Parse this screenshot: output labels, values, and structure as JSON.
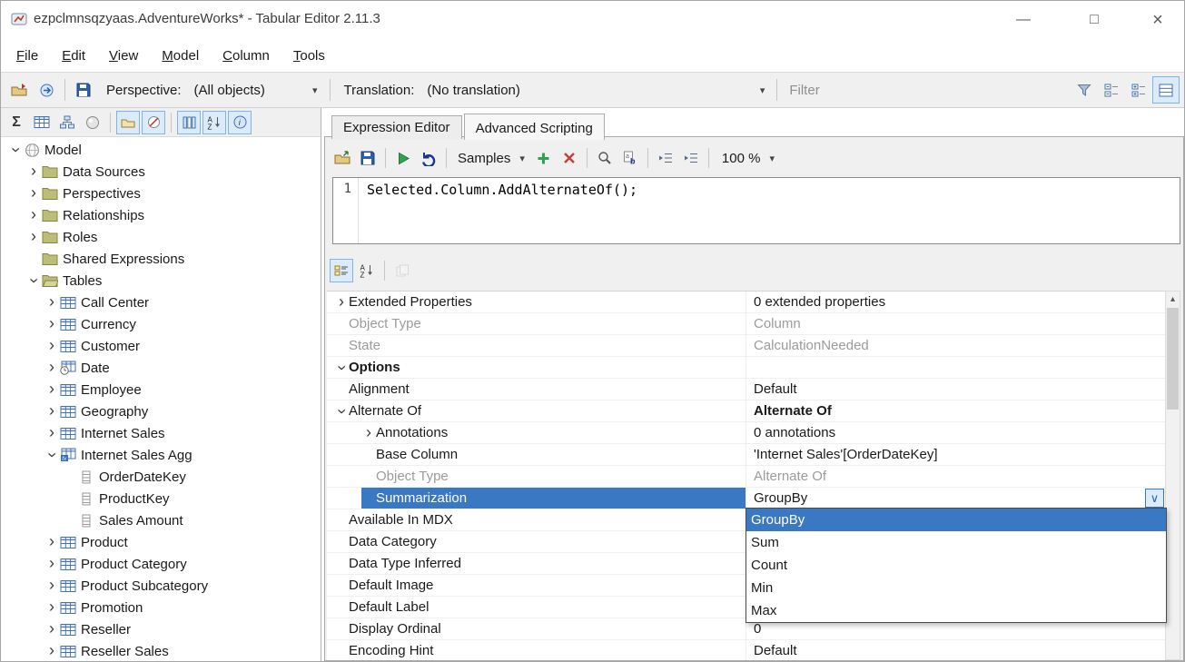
{
  "window": {
    "title": "ezpclmnsqzyaas.AdventureWorks* - Tabular Editor 2.11.3",
    "controls": {
      "minimize": "—",
      "maximize": "□",
      "close": "×"
    }
  },
  "menu": {
    "items": [
      "File",
      "Edit",
      "View",
      "Model",
      "Column",
      "Tools"
    ]
  },
  "main_toolbar": {
    "perspective_label": "Perspective:",
    "perspective_value": "(All objects)",
    "translation_label": "Translation:",
    "translation_value": "(No translation)",
    "filter_placeholder": "Filter"
  },
  "explorer_tree": {
    "items": [
      {
        "label": "Model",
        "level": 0,
        "expand": "expanded",
        "icon": "model-icon"
      },
      {
        "label": "Data Sources",
        "level": 1,
        "expand": "collapsed",
        "icon": "folder-icon"
      },
      {
        "label": "Perspectives",
        "level": 1,
        "expand": "collapsed",
        "icon": "folder-icon"
      },
      {
        "label": "Relationships",
        "level": 1,
        "expand": "collapsed",
        "icon": "folder-icon"
      },
      {
        "label": "Roles",
        "level": 1,
        "expand": "collapsed",
        "icon": "folder-icon"
      },
      {
        "label": "Shared Expressions",
        "level": 1,
        "expand": "none",
        "icon": "folder-icon"
      },
      {
        "label": "Tables",
        "level": 1,
        "expand": "expanded",
        "icon": "folder-open-icon"
      },
      {
        "label": "Call Center",
        "level": 2,
        "expand": "collapsed",
        "icon": "table-icon"
      },
      {
        "label": "Currency",
        "level": 2,
        "expand": "collapsed",
        "icon": "table-icon"
      },
      {
        "label": "Customer",
        "level": 2,
        "expand": "collapsed",
        "icon": "table-icon"
      },
      {
        "label": "Date",
        "level": 2,
        "expand": "collapsed",
        "icon": "date-table-icon"
      },
      {
        "label": "Employee",
        "level": 2,
        "expand": "collapsed",
        "icon": "table-icon"
      },
      {
        "label": "Geography",
        "level": 2,
        "expand": "collapsed",
        "icon": "table-icon"
      },
      {
        "label": "Internet Sales",
        "level": 2,
        "expand": "collapsed",
        "icon": "table-icon"
      },
      {
        "label": "Internet Sales Agg",
        "level": 2,
        "expand": "expanded",
        "icon": "agg-table-icon"
      },
      {
        "label": "OrderDateKey",
        "level": 3,
        "expand": "none",
        "icon": "column-icon"
      },
      {
        "label": "ProductKey",
        "level": 3,
        "expand": "none",
        "icon": "column-icon"
      },
      {
        "label": "Sales Amount",
        "level": 3,
        "expand": "none",
        "icon": "column-icon"
      },
      {
        "label": "Product",
        "level": 2,
        "expand": "collapsed",
        "icon": "table-icon"
      },
      {
        "label": "Product Category",
        "level": 2,
        "expand": "collapsed",
        "icon": "table-icon"
      },
      {
        "label": "Product Subcategory",
        "level": 2,
        "expand": "collapsed",
        "icon": "table-icon"
      },
      {
        "label": "Promotion",
        "level": 2,
        "expand": "collapsed",
        "icon": "table-icon"
      },
      {
        "label": "Reseller",
        "level": 2,
        "expand": "collapsed",
        "icon": "table-icon"
      },
      {
        "label": "Reseller Sales",
        "level": 2,
        "expand": "collapsed",
        "icon": "table-icon"
      }
    ]
  },
  "editor_tabs": {
    "items": [
      "Expression Editor",
      "Advanced Scripting"
    ],
    "active": "Advanced Scripting"
  },
  "script_toolbar": {
    "samples_label": "Samples",
    "zoom_value": "100 %"
  },
  "script_editor": {
    "line_number": "1",
    "code": "Selected.Column.AddAlternateOf();"
  },
  "property_grid": {
    "rows": [
      {
        "name": "Extended Properties",
        "value": "0 extended properties",
        "level": 0,
        "expand": "collapsed"
      },
      {
        "name": "Object Type",
        "value": "Column",
        "level": 0,
        "muted": true
      },
      {
        "name": "State",
        "value": "CalculationNeeded",
        "level": 0,
        "muted": true
      },
      {
        "name": "Options",
        "value": "",
        "level": 0,
        "expand": "expanded",
        "category": true
      },
      {
        "name": "Alignment",
        "value": "Default",
        "level": 0
      },
      {
        "name": "Alternate Of",
        "value": "Alternate Of",
        "level": 0,
        "expand": "expanded",
        "bold_value": true
      },
      {
        "name": "Annotations",
        "value": "0 annotations",
        "level": 1,
        "expand": "collapsed"
      },
      {
        "name": "Base Column",
        "value": "'Internet Sales'[OrderDateKey]",
        "level": 1
      },
      {
        "name": "Object Type",
        "value": "Alternate Of",
        "level": 1,
        "muted": true
      },
      {
        "name": "Summarization",
        "value": "GroupBy",
        "level": 1,
        "selected": true,
        "combo": true
      },
      {
        "name": "Available In MDX",
        "value": "",
        "level": 0
      },
      {
        "name": "Data Category",
        "value": "",
        "level": 0
      },
      {
        "name": "Data Type Inferred",
        "value": "",
        "level": 0
      },
      {
        "name": "Default Image",
        "value": "",
        "level": 0
      },
      {
        "name": "Default Label",
        "value": "",
        "level": 0
      },
      {
        "name": "Display Ordinal",
        "value": "0",
        "level": 0
      },
      {
        "name": "Encoding Hint",
        "value": "Default",
        "level": 0
      }
    ]
  },
  "summarization_dropdown": {
    "items": [
      "GroupBy",
      "Sum",
      "Count",
      "Min",
      "Max"
    ],
    "selected": "GroupBy"
  },
  "colors": {
    "highlight": "#3b78c3",
    "selection_text": "#ffffff",
    "toolbar_bg": "#f0f0f0",
    "muted_text": "#9b9b9b",
    "folder_icon": "#bdbd7a",
    "table_icon": "#4472b9",
    "run_green": "#2ea44f",
    "delete_red": "#c24038",
    "undo_blue": "#16368c"
  }
}
